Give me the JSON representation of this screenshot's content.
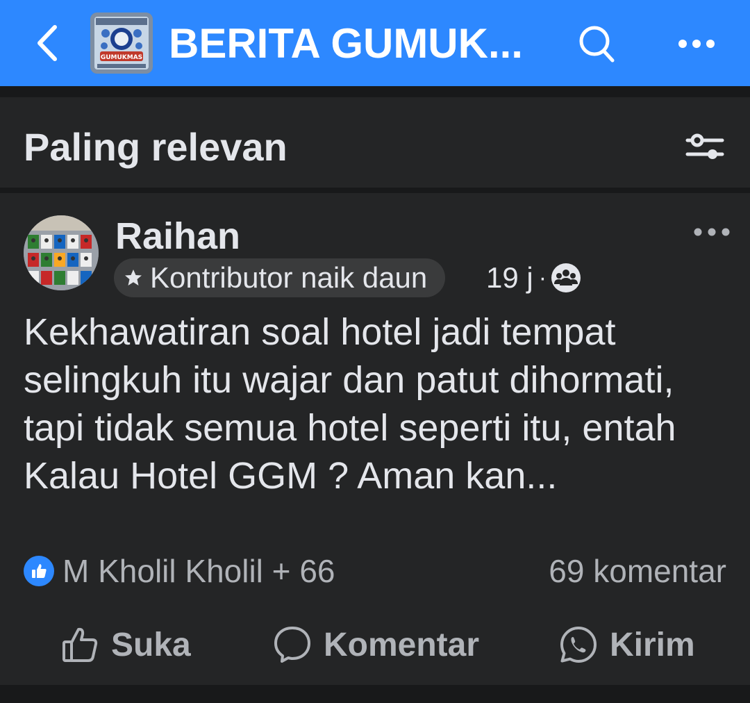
{
  "header": {
    "group_name": "BERITA GUMUK...",
    "thumb_text": "GUMUKMAS"
  },
  "sort": {
    "label": "Paling relevan"
  },
  "post": {
    "author": "Raihan",
    "badge": "Kontributor naik daun",
    "time": "19 j",
    "separator": "·",
    "text": "Kekhawatiran soal hotel jadi tempat selingkuh itu wajar dan patut dihormati, tapi tidak semua hotel seperti itu, entah Kalau Hotel GGM ? Aman kan...",
    "reactions_text": "M Kholil Kholil + 66",
    "comments_text": "69 komentar"
  },
  "actions": {
    "like": "Suka",
    "comment": "Komentar",
    "send": "Kirim"
  },
  "colors": {
    "header_bg": "#2d88ff",
    "card_bg": "#242526",
    "page_bg": "#18191a",
    "text_primary": "#e4e6eb",
    "text_secondary": "#b0b3b8",
    "like_blue": "#2d88ff"
  },
  "icons": {
    "back": "chevron-left-icon",
    "search": "search-icon",
    "more": "more-horizontal-icon",
    "filter": "sliders-icon",
    "badge": "star-icon",
    "audience": "group-icon",
    "like_reaction": "thumbs-up-icon",
    "like_action": "thumbs-up-outline-icon",
    "comment_action": "speech-bubble-icon",
    "send_action": "whatsapp-icon"
  }
}
